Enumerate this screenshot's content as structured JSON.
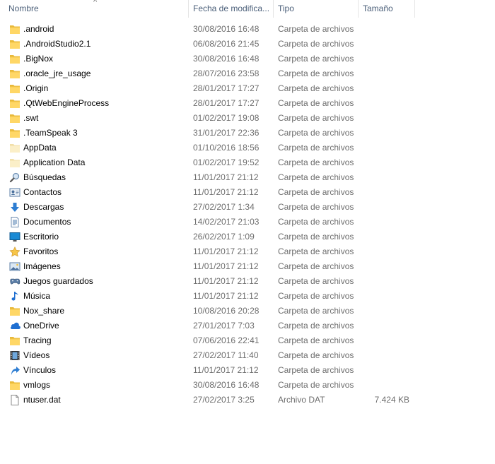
{
  "header": {
    "columns": {
      "name": "Nombre",
      "date": "Fecha de modifica...",
      "type": "Tipo",
      "size": "Tamaño"
    },
    "sort_indicator": "^"
  },
  "rows": [
    {
      "name": ".android",
      "date": "30/08/2016 16:48",
      "type": "Carpeta de archivos",
      "size": "",
      "icon": "folder-icon"
    },
    {
      "name": ".AndroidStudio2.1",
      "date": "06/08/2016 21:45",
      "type": "Carpeta de archivos",
      "size": "",
      "icon": "folder-icon"
    },
    {
      "name": ".BigNox",
      "date": "30/08/2016 16:48",
      "type": "Carpeta de archivos",
      "size": "",
      "icon": "folder-icon"
    },
    {
      "name": ".oracle_jre_usage",
      "date": "28/07/2016 23:58",
      "type": "Carpeta de archivos",
      "size": "",
      "icon": "folder-icon"
    },
    {
      "name": ".Origin",
      "date": "28/01/2017 17:27",
      "type": "Carpeta de archivos",
      "size": "",
      "icon": "folder-icon"
    },
    {
      "name": ".QtWebEngineProcess",
      "date": "28/01/2017 17:27",
      "type": "Carpeta de archivos",
      "size": "",
      "icon": "folder-icon"
    },
    {
      "name": ".swt",
      "date": "01/02/2017 19:08",
      "type": "Carpeta de archivos",
      "size": "",
      "icon": "folder-icon"
    },
    {
      "name": ".TeamSpeak 3",
      "date": "31/01/2017 22:36",
      "type": "Carpeta de archivos",
      "size": "",
      "icon": "folder-icon"
    },
    {
      "name": "AppData",
      "date": "01/10/2016 18:56",
      "type": "Carpeta de archivos",
      "size": "",
      "icon": "hidden-folder-icon"
    },
    {
      "name": "Application Data",
      "date": "01/02/2017 19:52",
      "type": "Carpeta de archivos",
      "size": "",
      "icon": "hidden-folder-icon"
    },
    {
      "name": "Búsquedas",
      "date": "11/01/2017 21:12",
      "type": "Carpeta de archivos",
      "size": "",
      "icon": "searches-icon"
    },
    {
      "name": "Contactos",
      "date": "11/01/2017 21:12",
      "type": "Carpeta de archivos",
      "size": "",
      "icon": "contacts-icon"
    },
    {
      "name": "Descargas",
      "date": "27/02/2017 1:34",
      "type": "Carpeta de archivos",
      "size": "",
      "icon": "downloads-icon"
    },
    {
      "name": "Documentos",
      "date": "14/02/2017 21:03",
      "type": "Carpeta de archivos",
      "size": "",
      "icon": "documents-icon"
    },
    {
      "name": "Escritorio",
      "date": "26/02/2017 1:09",
      "type": "Carpeta de archivos",
      "size": "",
      "icon": "desktop-icon"
    },
    {
      "name": "Favoritos",
      "date": "11/01/2017 21:12",
      "type": "Carpeta de archivos",
      "size": "",
      "icon": "favorites-icon"
    },
    {
      "name": "Imágenes",
      "date": "11/01/2017 21:12",
      "type": "Carpeta de archivos",
      "size": "",
      "icon": "pictures-icon"
    },
    {
      "name": "Juegos guardados",
      "date": "11/01/2017 21:12",
      "type": "Carpeta de archivos",
      "size": "",
      "icon": "saved-games-icon"
    },
    {
      "name": "Música",
      "date": "11/01/2017 21:12",
      "type": "Carpeta de archivos",
      "size": "",
      "icon": "music-icon"
    },
    {
      "name": "Nox_share",
      "date": "10/08/2016 20:28",
      "type": "Carpeta de archivos",
      "size": "",
      "icon": "folder-icon"
    },
    {
      "name": "OneDrive",
      "date": "27/01/2017 7:03",
      "type": "Carpeta de archivos",
      "size": "",
      "icon": "onedrive-icon"
    },
    {
      "name": "Tracing",
      "date": "07/06/2016 22:41",
      "type": "Carpeta de archivos",
      "size": "",
      "icon": "folder-icon"
    },
    {
      "name": "Vídeos",
      "date": "27/02/2017 11:40",
      "type": "Carpeta de archivos",
      "size": "",
      "icon": "videos-icon"
    },
    {
      "name": "Vínculos",
      "date": "11/01/2017 21:12",
      "type": "Carpeta de archivos",
      "size": "",
      "icon": "links-icon"
    },
    {
      "name": "vmlogs",
      "date": "30/08/2016 16:48",
      "type": "Carpeta de archivos",
      "size": "",
      "icon": "folder-icon"
    },
    {
      "name": "ntuser.dat",
      "date": "27/02/2017 3:25",
      "type": "Archivo DAT",
      "size": "7.424 KB",
      "icon": "file-icon"
    }
  ]
}
